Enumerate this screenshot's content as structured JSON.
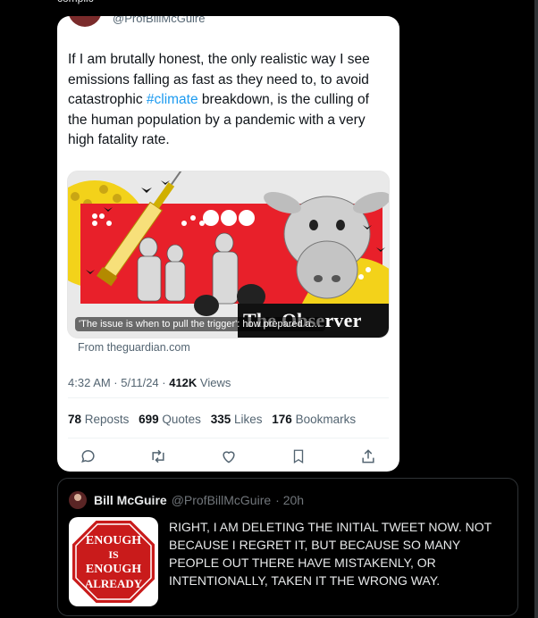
{
  "top_cut_text": "complic",
  "tweet": {
    "handle": "@ProfBillMcGuire",
    "text_before": "If I am brutally honest, the only realistic way I see emissions falling as fast as they need to, to avoid catastrophic ",
    "hashtag": "#climate",
    "text_after": " breakdown, is the culling of the human population by a pandemic with a very high fatality rate.",
    "media": {
      "caption": "'The issue is when to pull the trigger': how prepared are w...",
      "masthead": "The Observer"
    },
    "source": "From theguardian.com",
    "time": "4:32 AM · 5/11/24 · ",
    "views_value": "412K",
    "views_label": " Views",
    "stats": {
      "reposts_value": "78",
      "reposts_label": "Reposts",
      "quotes_value": "699",
      "quotes_label": "Quotes",
      "likes_value": "335",
      "likes_label": "Likes",
      "bookmarks_value": "176",
      "bookmarks_label": "Bookmarks"
    },
    "actions": [
      "reply-icon",
      "retweet-icon",
      "like-icon",
      "bookmark-icon",
      "share-icon"
    ]
  },
  "reply": {
    "name": "Bill McGuire",
    "handle": "@ProfBillMcGuire",
    "time": "· 20h",
    "sign_lines": [
      "ENOUGH",
      "IS",
      "ENOUGH",
      "ALREADY"
    ],
    "text": "RIGHT, I AM DELETING THE INITIAL TWEET NOW. NOT BECAUSE I REGRET IT, BUT BECAUSE SO MANY PEOPLE OUT THERE HAVE MISTAKENLY, OR INTENTIONALLY, TAKEN IT THE WRONG WAY."
  },
  "colors": {
    "accent": "#1d9bf0",
    "muted": "#536471",
    "poster_red": "#e8202a",
    "poster_yellow": "#f3d21a"
  }
}
